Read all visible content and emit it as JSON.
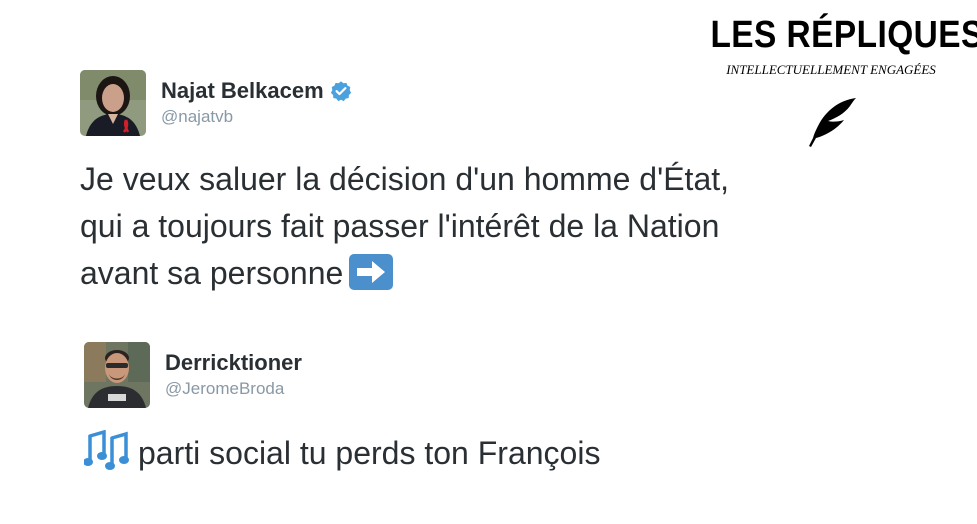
{
  "brand": {
    "title": "LES RÉPLIQUES",
    "subtitle": "INTELLECTUELLEMENT ENGAGÉES",
    "icon": "quill-icon"
  },
  "tweets": [
    {
      "author": "Najat Belkacem",
      "handle": "@najatvb",
      "verified": true,
      "text_lines": [
        "Je veux saluer la décision d'un homme d'État,",
        "qui a toujours fait passer l'intérêt de la Nation",
        "avant sa personne"
      ],
      "trailing_emoji": "right-arrow-emoji",
      "colors": {
        "verified": "#4aa1de",
        "emoji": "#4b8fcd"
      }
    },
    {
      "author": "Derricktioner",
      "handle": "@JeromeBroda",
      "verified": false,
      "text": "parti social tu perds ton François",
      "leading_emoji": "musical-notes-emoji",
      "colors": {
        "emoji": "#3b8fd6"
      }
    }
  ],
  "colors": {
    "text": "#292f33",
    "handle": "#8899a6",
    "background": "#ffffff"
  }
}
